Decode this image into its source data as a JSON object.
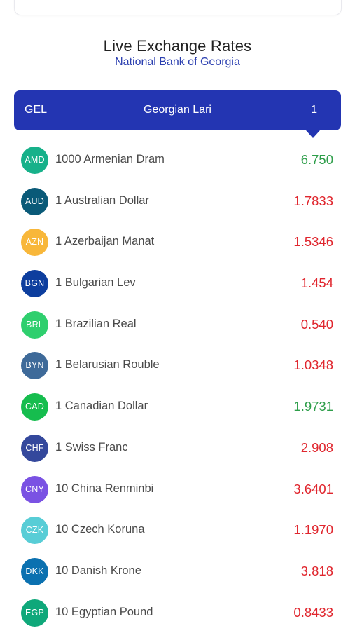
{
  "header": {
    "title": "Live Exchange Rates",
    "subtitle": "National Bank of Georgia"
  },
  "base_currency": {
    "code": "GEL",
    "name": "Georgian Lari",
    "amount": "1",
    "color": "#2335b2"
  },
  "rates": [
    {
      "code": "AMD",
      "label": "1000 Armenian Dram",
      "value": "6.750",
      "badge_color": "#17b18a",
      "trend": "up",
      "value_color": "#2e9e4a"
    },
    {
      "code": "AUD",
      "label": "1 Australian Dollar",
      "value": "1.7833",
      "badge_color": "#0a5a78",
      "trend": "down",
      "value_color": "#e0262e"
    },
    {
      "code": "AZN",
      "label": "1 Azerbaijan Manat",
      "value": "1.5346",
      "badge_color": "#f8b73a",
      "trend": "down",
      "value_color": "#e0262e"
    },
    {
      "code": "BGN",
      "label": "1 Bulgarian Lev",
      "value": "1.454",
      "badge_color": "#0d3e9e",
      "trend": "down",
      "value_color": "#e0262e"
    },
    {
      "code": "BRL",
      "label": "1 Brazilian Real",
      "value": "0.540",
      "badge_color": "#2fcf6e",
      "trend": "down",
      "value_color": "#e0262e"
    },
    {
      "code": "BYN",
      "label": "1 Belarusian Rouble",
      "value": "1.0348",
      "badge_color": "#3e6a99",
      "trend": "down",
      "value_color": "#e0262e"
    },
    {
      "code": "CAD",
      "label": "1 Canadian Dollar",
      "value": "1.9731",
      "badge_color": "#16bd4e",
      "trend": "up",
      "value_color": "#2e9e4a"
    },
    {
      "code": "CHF",
      "label": "1 Swiss Franc",
      "value": "2.908",
      "badge_color": "#34489c",
      "trend": "down",
      "value_color": "#e0262e"
    },
    {
      "code": "CNY",
      "label": "10 China Renminbi",
      "value": "3.6401",
      "badge_color": "#7a52e3",
      "trend": "down",
      "value_color": "#e0262e"
    },
    {
      "code": "CZK",
      "label": "10 Czech Koruna",
      "value": "1.1970",
      "badge_color": "#58cdd6",
      "trend": "down",
      "value_color": "#e0262e"
    },
    {
      "code": "DKK",
      "label": "10 Danish Krone",
      "value": "3.818",
      "badge_color": "#0b71b0",
      "trend": "down",
      "value_color": "#e0262e"
    },
    {
      "code": "EGP",
      "label": "10 Egyptian Pound",
      "value": "0.8433",
      "badge_color": "#0fa87a",
      "trend": "down",
      "value_color": "#e0262e"
    }
  ]
}
